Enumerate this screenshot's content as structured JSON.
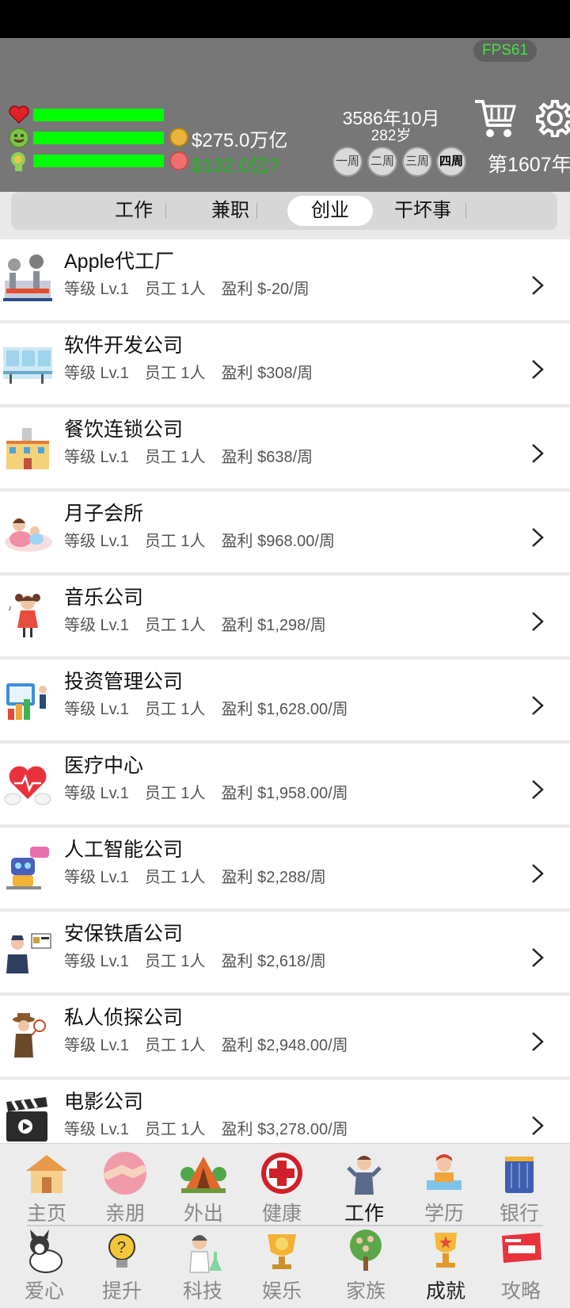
{
  "hud": {
    "fps": "FPS61",
    "money": "$275.0万亿",
    "money2": "$132.0亿?",
    "date": "3586年10月",
    "age": "282岁",
    "weeks": [
      "一周",
      "二周",
      "三周",
      "四周"
    ],
    "year_label": "第1607年",
    "colors": {
      "bar": "#00ff00",
      "panel": "#777777",
      "money2": "#1eb91e"
    }
  },
  "tabs": [
    "工作",
    "兼职",
    "创业",
    "干坏事"
  ],
  "active_tab": "创业",
  "businesses": [
    {
      "name": "Apple代工厂",
      "level": "等级 Lv.1",
      "staff": "员工 1人",
      "profit": "盈利 $-20/周",
      "icon": "factory-icon"
    },
    {
      "name": "软件开发公司",
      "level": "等级 Lv.1",
      "staff": "员工 1人",
      "profit": "盈利 $308/周",
      "icon": "office-icon"
    },
    {
      "name": "餐饮连锁公司",
      "level": "等级 Lv.1",
      "staff": "员工 1人",
      "profit": "盈利 $638/周",
      "icon": "building-icon"
    },
    {
      "name": "月子会所",
      "level": "等级 Lv.1",
      "staff": "员工 1人",
      "profit": "盈利 $968.00/周",
      "icon": "mother-icon"
    },
    {
      "name": "音乐公司",
      "level": "等级 Lv.1",
      "staff": "员工 1人",
      "profit": "盈利 $1,298/周",
      "icon": "singer-icon"
    },
    {
      "name": "投资管理公司",
      "level": "等级 Lv.1",
      "staff": "员工 1人",
      "profit": "盈利 $1,628.00/周",
      "icon": "chart-icon"
    },
    {
      "name": "医疗中心",
      "level": "等级 Lv.1",
      "staff": "员工 1人",
      "profit": "盈利 $1,958.00/周",
      "icon": "heart-hand-icon"
    },
    {
      "name": "人工智能公司",
      "level": "等级 Lv.1",
      "staff": "员工 1人",
      "profit": "盈利 $2,288/周",
      "icon": "robot-icon"
    },
    {
      "name": "安保铁盾公司",
      "level": "等级 Lv.1",
      "staff": "员工 1人",
      "profit": "盈利 $2,618/周",
      "icon": "guard-icon"
    },
    {
      "name": "私人侦探公司",
      "level": "等级 Lv.1",
      "staff": "员工 1人",
      "profit": "盈利 $2,948.00/周",
      "icon": "detective-icon"
    },
    {
      "name": "电影公司",
      "level": "等级 Lv.1",
      "staff": "员工 1人",
      "profit": "盈利 $3,278.00/周",
      "icon": "clapper-icon"
    }
  ],
  "nav": {
    "row1": [
      "主页",
      "亲朋",
      "外出",
      "健康",
      "工作",
      "学历",
      "银行"
    ],
    "row2": [
      "爱心",
      "提升",
      "科技",
      "娱乐",
      "家族",
      "成就",
      "攻略"
    ],
    "active": "工作"
  }
}
